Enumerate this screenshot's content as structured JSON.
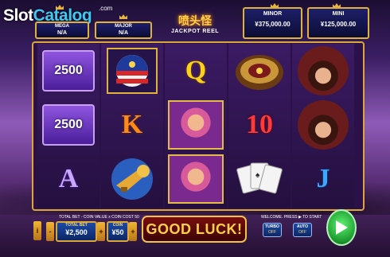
{
  "watermark": {
    "main": "Slot",
    "accent": "Catalog",
    "suffix": ".com"
  },
  "jackpots": [
    {
      "title": "MEGA",
      "value": "N/A"
    },
    {
      "title": "MAJOR",
      "value": "N/A"
    },
    {
      "title": "MINOR",
      "value": "¥375,000.00"
    },
    {
      "title": "MINI",
      "value": "¥125,000.00"
    }
  ],
  "logo": {
    "title": "喷头怪",
    "subtitle": "JACKPOT REEL"
  },
  "reels": [
    [
      {
        "type": "bonus",
        "text": "2500"
      },
      {
        "type": "bonus",
        "text": "2500"
      },
      {
        "type": "letter",
        "text": "A",
        "color": "#c8a8ff"
      }
    ],
    [
      {
        "type": "symbol",
        "icon": "eagle-shield-icon"
      },
      {
        "type": "letter",
        "text": "K",
        "color": "#ff8a1a"
      },
      {
        "type": "symbol",
        "icon": "trumpet-icon"
      }
    ],
    [
      {
        "type": "letter",
        "text": "Q",
        "color": "#ffd21a"
      },
      {
        "type": "symbol",
        "icon": "showgirl-icon"
      },
      {
        "type": "symbol",
        "icon": "showgirl-icon"
      }
    ],
    [
      {
        "type": "symbol",
        "icon": "roulette-icon"
      },
      {
        "type": "letter",
        "text": "10",
        "color": "#ff3a3a"
      },
      {
        "type": "symbol",
        "icon": "cards-icon"
      }
    ],
    [
      {
        "type": "symbol",
        "icon": "gangster-icon"
      },
      {
        "type": "symbol",
        "icon": "gangster-icon"
      },
      {
        "type": "letter",
        "text": "J",
        "color": "#39a8ff"
      }
    ]
  ],
  "bottom": {
    "info_text": "TOTAL BET - COIN VALUE x COIN COST 50",
    "total_bet_label": "TOTAL BET",
    "total_bet_value": "¥2,500",
    "coin_label": "COIN",
    "coin_value": "¥50",
    "message": "GOOD LUCK!",
    "welcome_text": "WELCOME. PRESS ▶ TO START",
    "turbo_label": "TURBO",
    "turbo_state": "OFF",
    "auto_label": "AUTO",
    "auto_state": "OFF",
    "info_button": "i",
    "stepper_minus": "-",
    "stepper_plus": "+"
  },
  "colors": {
    "frame": "#d8a83a",
    "spin": "#1c9a2e",
    "panel": "#1b4aa6"
  }
}
